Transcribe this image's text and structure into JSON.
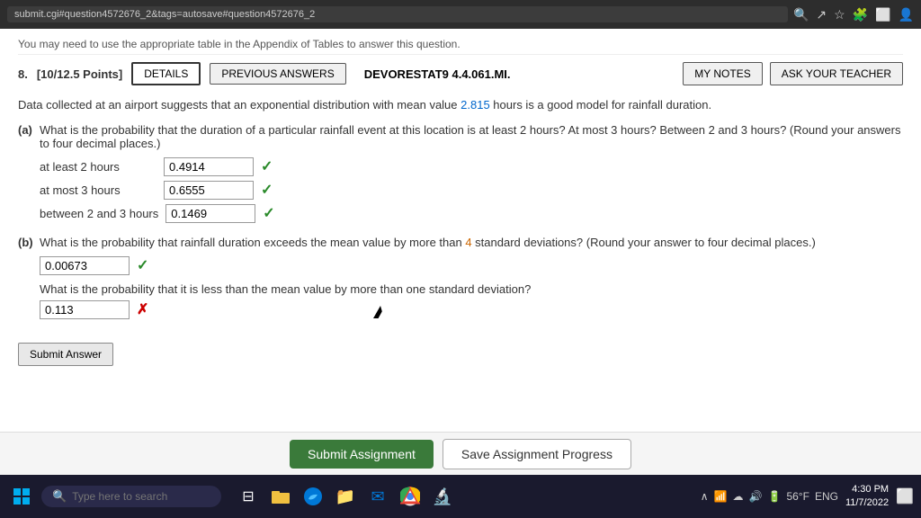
{
  "browser": {
    "url": "submit.cgi#question4572676_2&tags=autosave#question4572676_2",
    "top_text": "You may need to use the appropriate table in the Appendix of Tables to answer this question."
  },
  "question": {
    "number": "8.",
    "points": "[10/12.5 Points]",
    "tabs": {
      "details": "DETAILS",
      "previous_answers": "PREVIOUS ANSWERS"
    },
    "code": "DEVORESTAT9 4.4.061.MI.",
    "my_notes": "MY NOTES",
    "ask_teacher": "ASK YOUR TEACHER",
    "intro_text_1": "Data collected at an airport suggests that an exponential distribution with mean value ",
    "mean_value": "2.815",
    "intro_text_2": " hours is a good model for rainfall duration.",
    "part_a": {
      "label": "(a)",
      "question": "What is the probability that the duration of a particular rainfall event at this location is at least 2 hours? At most 3 hours? Between 2 and 3 hours? (Round your answers to four decimal places.)",
      "rows": [
        {
          "label": "at least 2 hours",
          "value": "0.4914",
          "status": "correct"
        },
        {
          "label": "at most 3 hours",
          "value": "0.6555",
          "status": "correct"
        },
        {
          "label": "between 2 and 3 hours",
          "value": "0.1469",
          "status": "correct"
        }
      ]
    },
    "part_b": {
      "label": "(b)",
      "question_1": "What is the probability that rainfall duration exceeds the mean value by more than ",
      "highlight_num": "4",
      "question_1_end": " standard deviations? (Round your answer to four decimal places.)",
      "answer_1": "0.00673",
      "status_1": "correct",
      "question_2": "What is the probability that it is less than the mean value by more than one standard deviation?",
      "answer_2": "0.113",
      "status_2": "incorrect"
    },
    "submit_answer_btn": "Submit Answer"
  },
  "actions": {
    "submit_assignment": "Submit Assignment",
    "save_progress": "Save Assignment Progress"
  },
  "taskbar": {
    "search_placeholder": "Type here to search",
    "weather": "56°F",
    "language": "ENG",
    "time": "4:30 PM",
    "date": "11/7/2022"
  }
}
